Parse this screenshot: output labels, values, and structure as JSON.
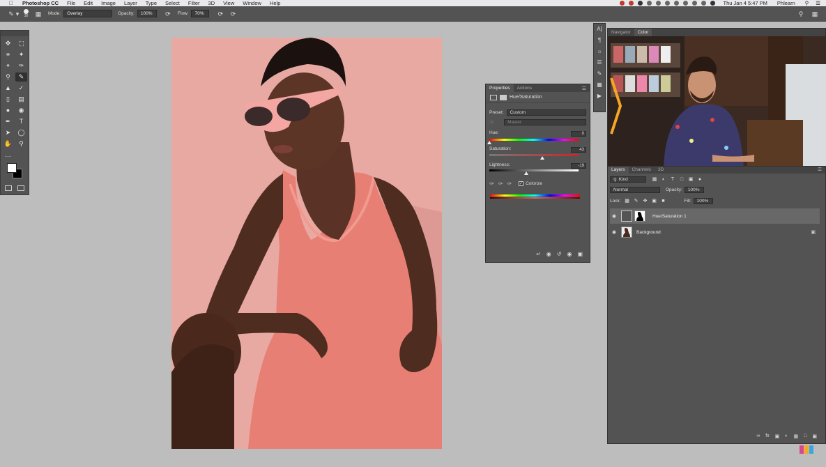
{
  "menubar": {
    "app_name": "Photoshop CC",
    "items": [
      "File",
      "Edit",
      "Image",
      "Layer",
      "Type",
      "Select",
      "Filter",
      "3D",
      "View",
      "Window",
      "Help"
    ],
    "clock": "Thu Jan 4  5:47 PM",
    "user": "Phlearn"
  },
  "options_bar": {
    "brush_size": "30",
    "mode_label": "Mode:",
    "mode_value": "Overlay",
    "opacity_label": "Opacity:",
    "opacity_value": "100%",
    "flow_label": "Flow:",
    "flow_value": "70%"
  },
  "properties": {
    "tabs": [
      "Properties",
      "Actions"
    ],
    "title": "Hue/Saturation",
    "preset_label": "Preset:",
    "preset_value": "Custom",
    "channel_value": "Master",
    "hue_label": "Hue:",
    "hue_value": "0",
    "hue_level": 0.0,
    "saturation_label": "Saturation:",
    "saturation_value": "43",
    "saturation_level": 0.43,
    "lightness_label": "Lightness:",
    "lightness_value": "-19",
    "lightness_level": -0.19,
    "colorize_label": "Colorize",
    "colorize_checked": true
  },
  "navigator": {
    "tabs": [
      "Navigator",
      "Color"
    ]
  },
  "layers": {
    "tabs": [
      "Layers",
      "Channels",
      "3D"
    ],
    "filter_value": "Kind",
    "blend_value": "Normal",
    "opacity_label": "Opacity:",
    "opacity_value": "100%",
    "lock_label": "Lock:",
    "fill_label": "Fill:",
    "fill_value": "100%",
    "items": [
      {
        "name": "Hue/Saturation 1",
        "selected": true
      },
      {
        "name": "Background",
        "selected": false
      }
    ]
  },
  "colors": {
    "canvas_tint": "#e8a9a3",
    "panel": "#535353",
    "workspace": "#bdbdbd"
  }
}
